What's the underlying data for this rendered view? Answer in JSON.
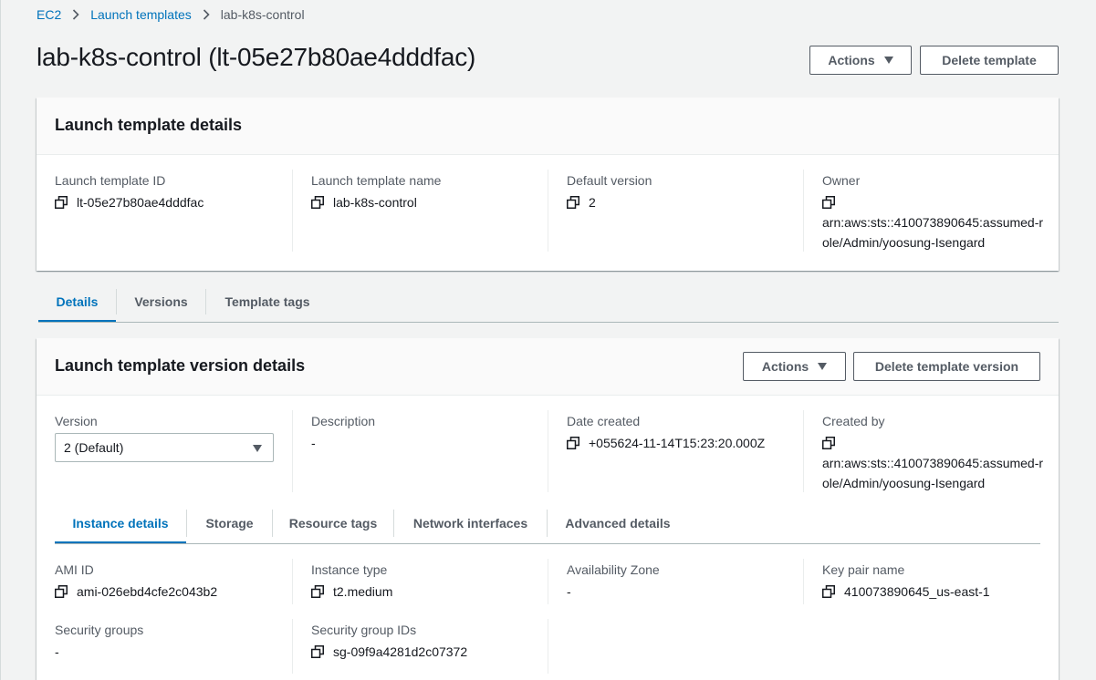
{
  "breadcrumb": {
    "items": [
      {
        "label": "EC2"
      },
      {
        "label": "Launch templates"
      },
      {
        "label": "lab-k8s-control"
      }
    ]
  },
  "page": {
    "title": "lab-k8s-control (lt-05e27b80ae4dddfac)",
    "actions_label": "Actions",
    "delete_label": "Delete template"
  },
  "template_details": {
    "title": "Launch template details",
    "fields": [
      {
        "label": "Launch template ID",
        "value": "lt-05e27b80ae4dddfac"
      },
      {
        "label": "Launch template name",
        "value": "lab-k8s-control"
      },
      {
        "label": "Default version",
        "value": "2"
      },
      {
        "label": "Owner",
        "value": "arn:aws:sts::410073890645:assumed-role/Admin/yoosung-Isengard"
      }
    ]
  },
  "main_tabs": [
    {
      "label": "Details",
      "active": true
    },
    {
      "label": "Versions",
      "active": false
    },
    {
      "label": "Template tags",
      "active": false
    }
  ],
  "version_details": {
    "title": "Launch template version details",
    "actions_label": "Actions",
    "delete_label": "Delete template version",
    "version_label": "Version",
    "version_selected": "2 (Default)",
    "description_label": "Description",
    "description_value": "-",
    "date_label": "Date created",
    "date_value": "+055624-11-14T15:23:20.000Z",
    "created_by_label": "Created by",
    "created_by_value": "arn:aws:sts::410073890645:assumed-role/Admin/yoosung-Isengard"
  },
  "sub_tabs": [
    {
      "label": "Instance details",
      "active": true
    },
    {
      "label": "Storage",
      "active": false
    },
    {
      "label": "Resource tags",
      "active": false
    },
    {
      "label": "Network interfaces",
      "active": false
    },
    {
      "label": "Advanced details",
      "active": false
    }
  ],
  "instance_details": {
    "ami_label": "AMI ID",
    "ami_value": "ami-026ebd4cfe2c043b2",
    "type_label": "Instance type",
    "type_value": "t2.medium",
    "az_label": "Availability Zone",
    "az_value": "-",
    "key_label": "Key pair name",
    "key_value": "410073890645_us-east-1",
    "sg_label": "Security groups",
    "sg_value": "-",
    "sgid_label": "Security group IDs",
    "sgid_value": "sg-09f9a4281d2c07372"
  },
  "colors": {
    "link": "#0073bb",
    "text": "#16191f",
    "muted": "#545b64",
    "background": "#f2f3f3"
  }
}
